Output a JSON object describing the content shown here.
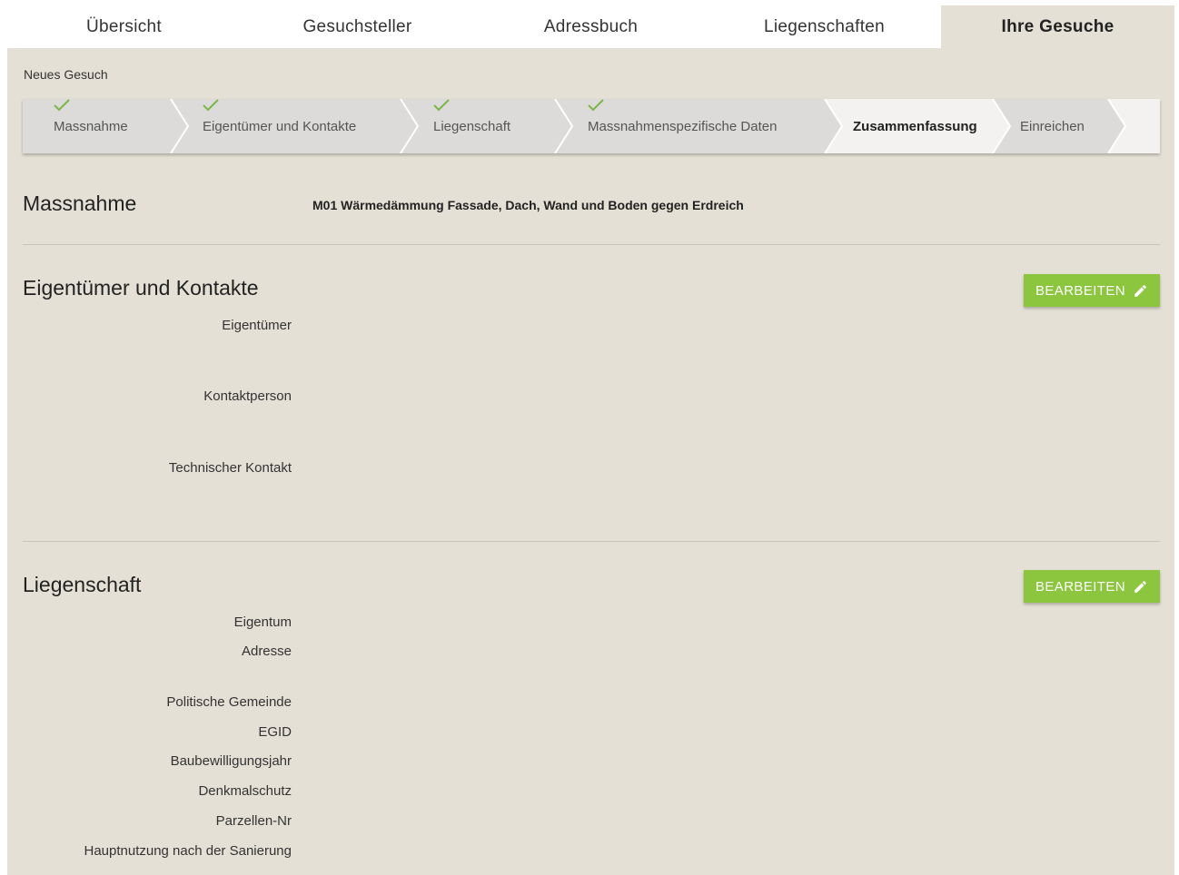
{
  "nav": {
    "tabs": [
      {
        "label": "Übersicht"
      },
      {
        "label": "Gesuchsteller"
      },
      {
        "label": "Adressbuch"
      },
      {
        "label": "Liegenschaften"
      },
      {
        "label": "Ihre Gesuche"
      }
    ],
    "active_index": 4
  },
  "breadcrumb": "Neues Gesuch",
  "stepper": {
    "steps": [
      {
        "label": "Massnahme",
        "state": "done"
      },
      {
        "label": "Eigentümer und Kontakte",
        "state": "done"
      },
      {
        "label": "Liegenschaft",
        "state": "done"
      },
      {
        "label": "Massnahmenspezifische Daten",
        "state": "done"
      },
      {
        "label": "Zusammenfassung",
        "state": "current"
      },
      {
        "label": "Einreichen",
        "state": "pending"
      }
    ]
  },
  "massnahme": {
    "title": "Massnahme",
    "value": "M01 Wärmedämmung Fassade, Dach, Wand und Boden gegen Erdreich"
  },
  "kontakte": {
    "title": "Eigentümer und Kontakte",
    "edit_label": "BEARBEITEN",
    "fields": [
      "Eigentümer",
      "Kontaktperson",
      "Technischer Kontakt"
    ]
  },
  "liegenschaft": {
    "title": "Liegenschaft",
    "edit_label": "BEARBEITEN",
    "fields": [
      "Eigentum",
      "Adresse",
      "Politische Gemeinde",
      "EGID",
      "Baubewilligungsjahr",
      "Denkmalschutz",
      "Parzellen-Nr",
      "Hauptnutzung nach der Sanierung"
    ]
  },
  "colors": {
    "accent_green": "#8cc63f",
    "check_green": "#7ab648",
    "page_bg": "#e5e0d5",
    "step_done_bg": "#dcdbd9"
  },
  "icons": {
    "step_done": "check-icon",
    "edit": "pencil-icon"
  }
}
